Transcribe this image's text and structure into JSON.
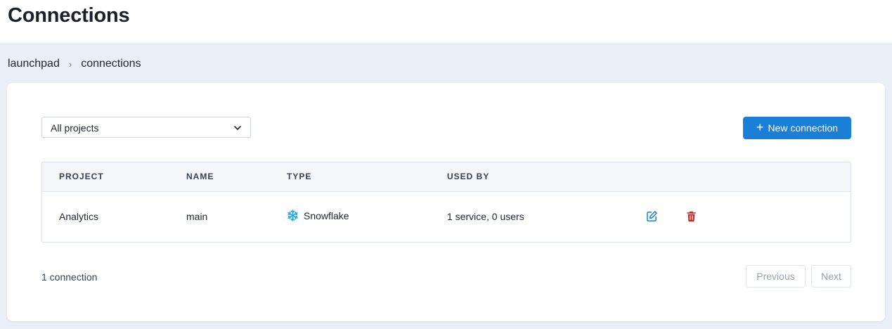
{
  "header": {
    "title": "Connections"
  },
  "breadcrumb": {
    "items": [
      "launchpad",
      "connections"
    ],
    "separator": "›"
  },
  "filter": {
    "selected": "All projects",
    "icon": "chevron-down-icon"
  },
  "actions": {
    "new_connection_label": "New connection",
    "new_connection_icon": "plus-icon"
  },
  "table": {
    "columns": [
      "PROJECT",
      "NAME",
      "TYPE",
      "USED BY"
    ],
    "rows": [
      {
        "project": "Analytics",
        "name": "main",
        "type": "Snowflake",
        "type_icon": "snowflake-icon",
        "used_by": "1 service, 0 users",
        "actions": [
          "edit-icon",
          "trash-icon"
        ]
      }
    ]
  },
  "footer": {
    "count_label": "1 connection",
    "previous_label": "Previous",
    "next_label": "Next"
  },
  "colors": {
    "accent": "#1a7fd6",
    "danger": "#c62828",
    "snowflake": "#29a8e0",
    "page_bg": "#eaeef6"
  }
}
